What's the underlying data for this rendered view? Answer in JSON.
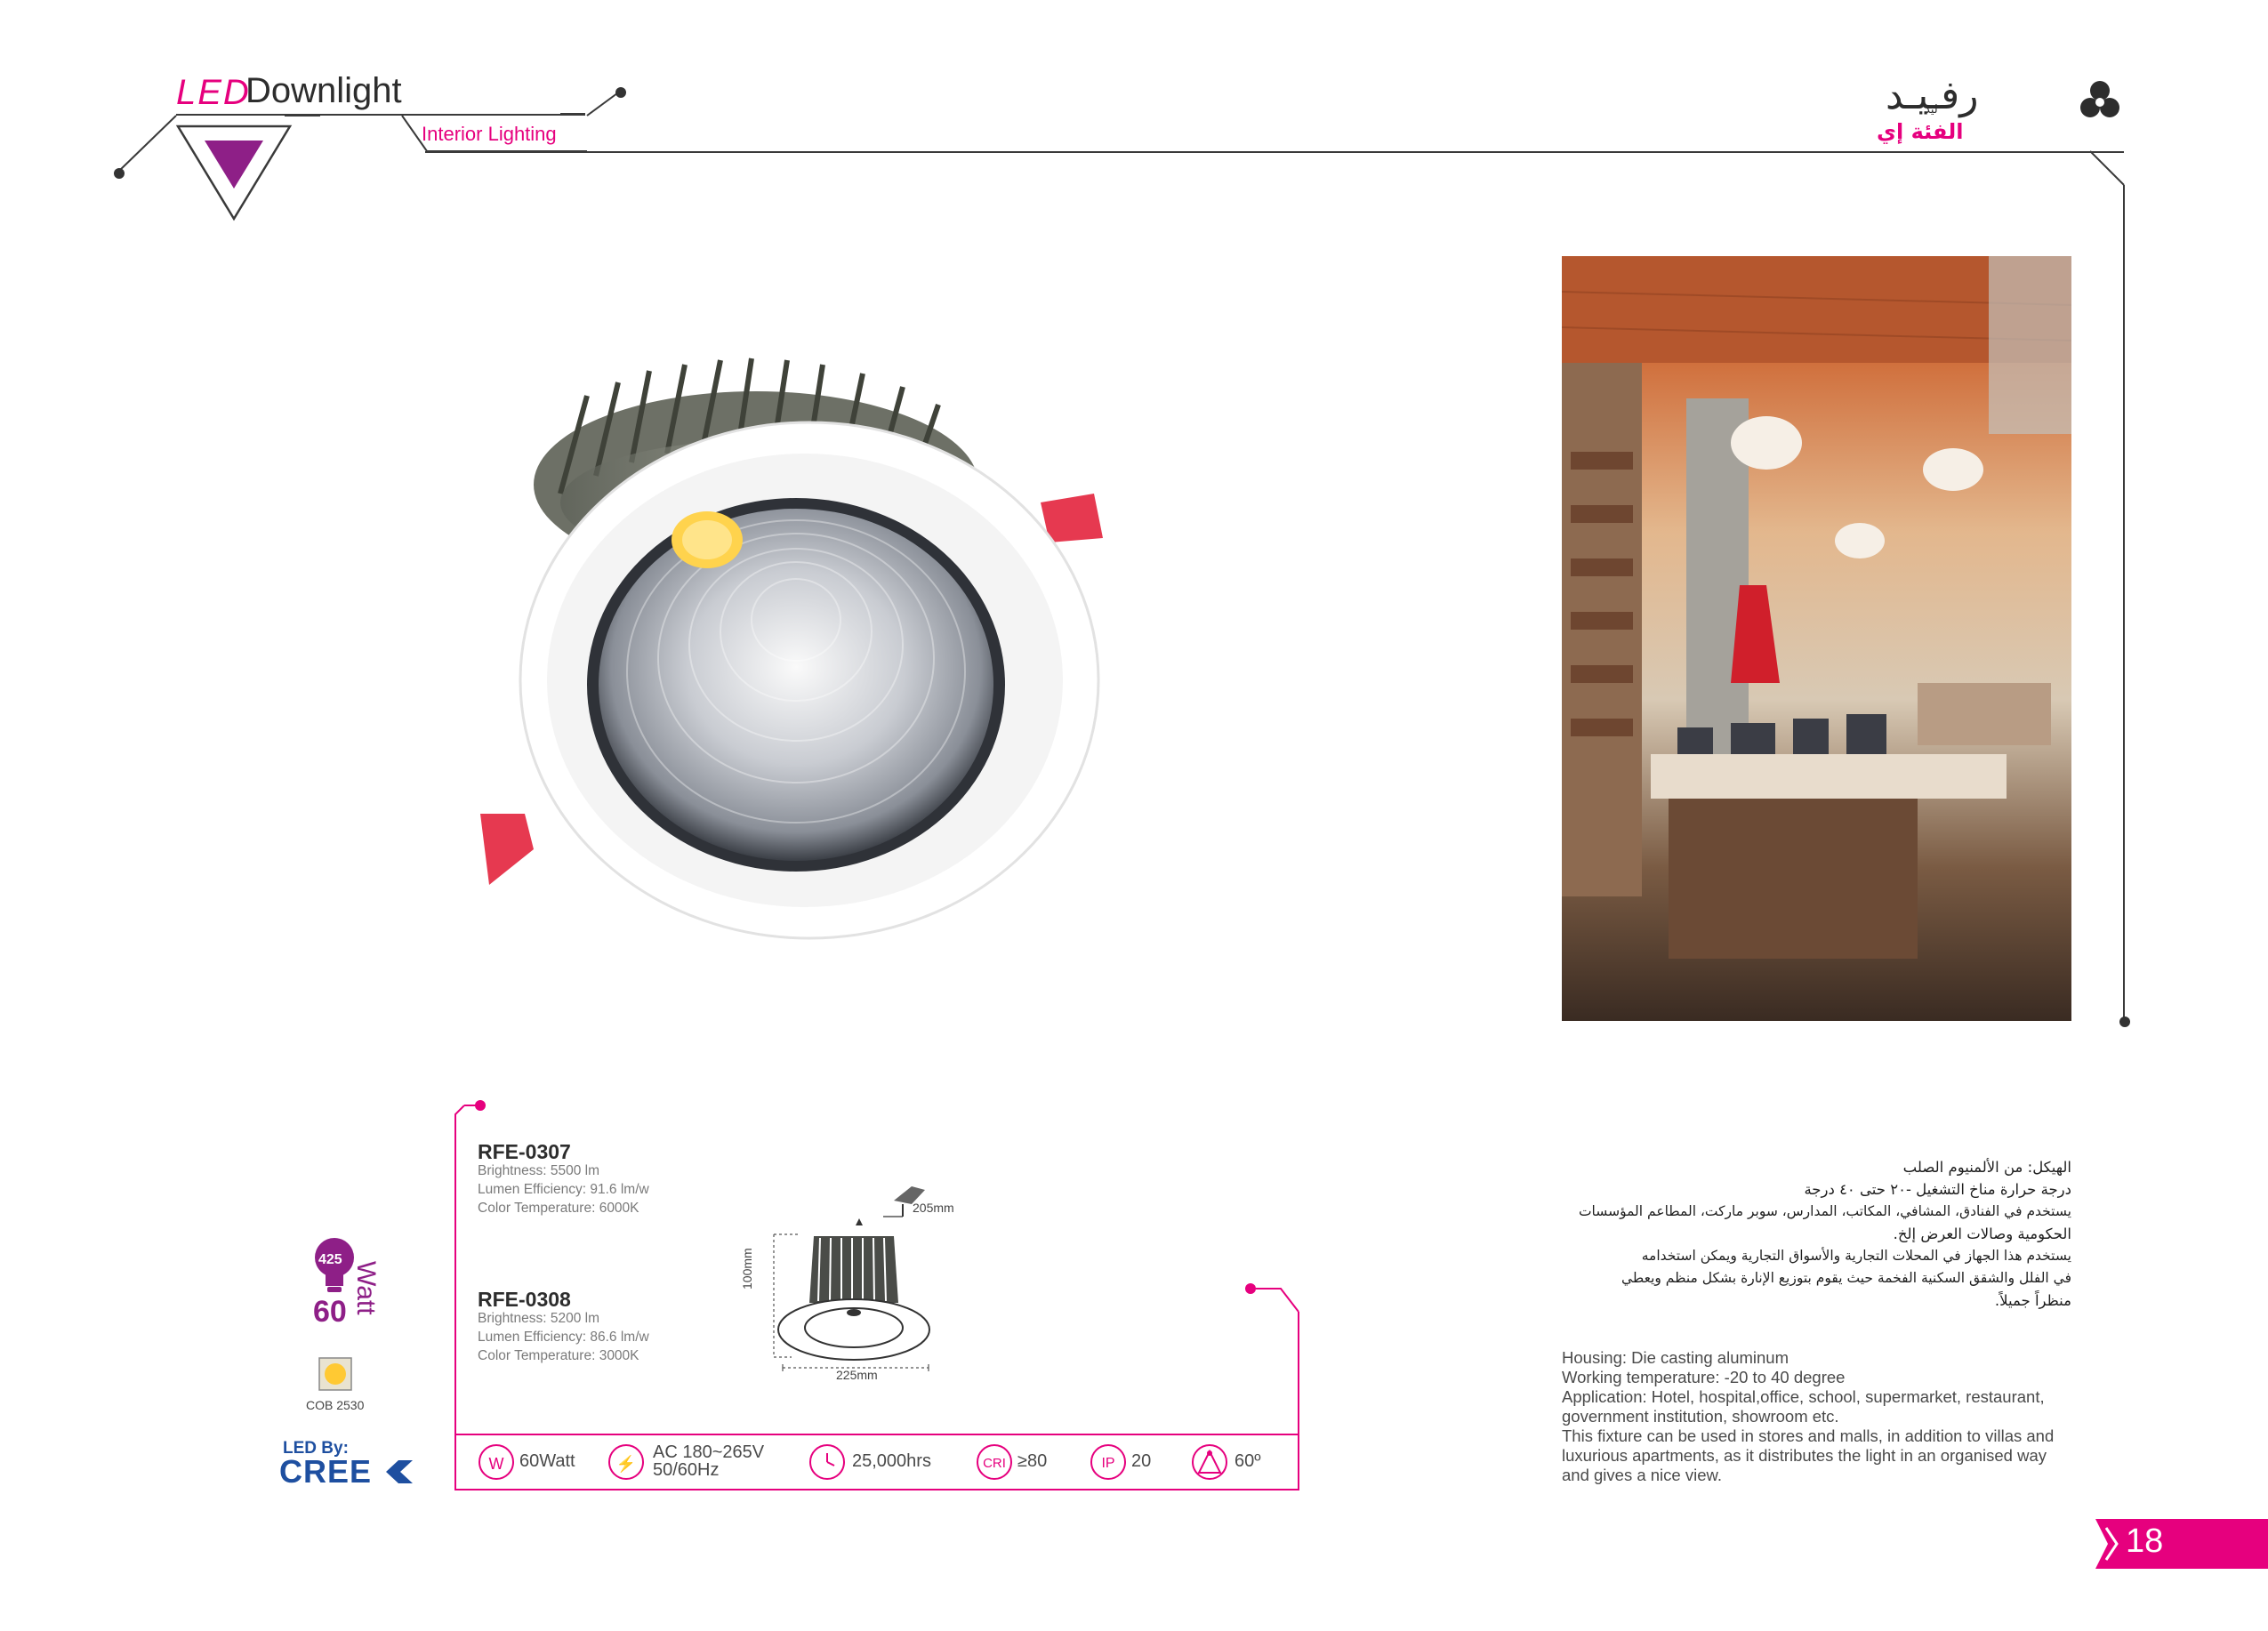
{
  "header": {
    "led": "LED",
    "title": "Downlight",
    "subtitle": "Interior Lighting",
    "brand_en": "Rafeed",
    "brand_ar": "رفـيـد",
    "brand_tag_small": "ليد",
    "brand_tag": "الفئة إي"
  },
  "products": [
    {
      "model": "RFE-0307",
      "brightness": "Brightness: 5500 lm",
      "efficiency": "Lumen Efficiency: 91.6 lm/w",
      "color_temp": "Color Temperature: 6000K"
    },
    {
      "model": "RFE-0308",
      "brightness": "Brightness: 5200 lm",
      "efficiency": "Lumen Efficiency: 86.6 lm/w",
      "color_temp": "Color Temperature: 3000K"
    }
  ],
  "dimensions": {
    "cutout": "205mm",
    "height": "100mm",
    "diameter": "225mm"
  },
  "badges": {
    "lamp_value": "425",
    "watt_number": "60",
    "watt_word": "Watt",
    "chip": "COB 2530",
    "led_by": "LED By:",
    "cree": "CREE"
  },
  "specs_bar": [
    {
      "icon": "W",
      "value": "60Watt"
    },
    {
      "icon": "⚡",
      "value": "AC 180~265V",
      "value2": "50/60Hz"
    },
    {
      "icon": "clock",
      "value": "25,000hrs"
    },
    {
      "icon": "CRI",
      "value": "≥80"
    },
    {
      "icon": "IP",
      "value": "20"
    },
    {
      "icon": "beam",
      "value": "60º"
    }
  ],
  "arabic_lines": [
    "الهيكل: من الألمنيوم الصلب",
    "درجة حرارة مناخ التشغيل -٢٠ حتى ٤٠ درجة",
    "يستخدم في الفنادق، المشافي، المكاتب، المدارس، سوبر ماركت، المطاعم المؤسسات",
    "الحكومية وصالات العرض إلخ.",
    "يستخدم هذا الجهاز في المحلات التجارية والأسواق التجارية ويمكن استخدامه",
    "في الفلل والشقق السكنية الفخمة حيث يقوم بتوزيع الإنارة بشكل منظم ويعطي",
    "منظراً جميلاً."
  ],
  "english_lines": [
    "Housing: Die casting aluminum",
    "Working temperature: -20 to 40 degree",
    "Application: Hotel, hospital,office, school, supermarket, restaurant,",
    "government institution, showroom etc.",
    "This fixture can be used in stores and malls, in addition to villas and",
    "luxurious apartments, as it distributes the light in an organised way",
    "and gives a nice view."
  ],
  "page_number": "18",
  "colors": {
    "accent": "#e6007e",
    "purple": "#8e1f87",
    "line": "#3a3a3a"
  }
}
